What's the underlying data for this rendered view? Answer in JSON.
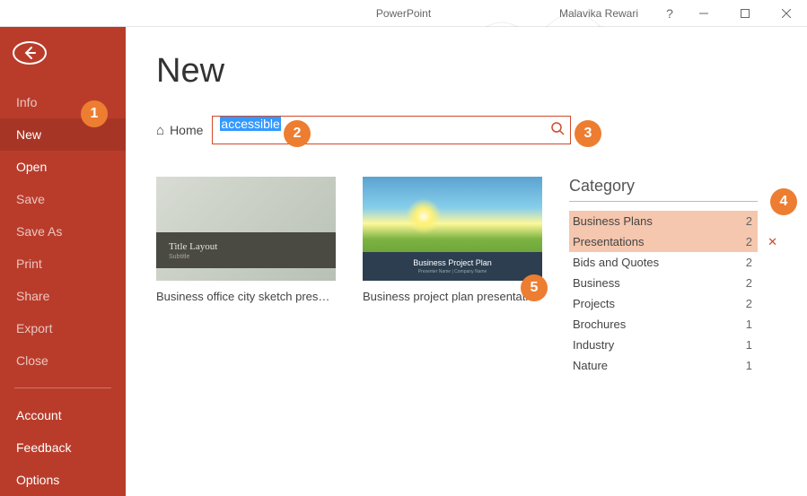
{
  "titlebar": {
    "app": "PowerPoint",
    "user": "Malavika Rewari"
  },
  "sidebar": {
    "back": "←",
    "items": [
      {
        "label": "Info",
        "active": false,
        "strong": false
      },
      {
        "label": "New",
        "active": true,
        "strong": true
      },
      {
        "label": "Open",
        "active": false,
        "strong": true
      },
      {
        "label": "Save",
        "active": false,
        "strong": false
      },
      {
        "label": "Save As",
        "active": false,
        "strong": false
      },
      {
        "label": "Print",
        "active": false,
        "strong": false
      },
      {
        "label": "Share",
        "active": false,
        "strong": false
      },
      {
        "label": "Export",
        "active": false,
        "strong": false
      },
      {
        "label": "Close",
        "active": false,
        "strong": false
      }
    ],
    "footer": [
      {
        "label": "Account"
      },
      {
        "label": "Feedback"
      },
      {
        "label": "Options"
      }
    ]
  },
  "page": {
    "title": "New",
    "home": "Home",
    "search_value": "accessible"
  },
  "templates": [
    {
      "label": "Business office city sketch prese…",
      "title": "Title Layout",
      "subtitle": "Subtitle"
    },
    {
      "label": "Business project plan presentatio…",
      "title": "Business Project Plan",
      "subtitle": "Presenter Name | Company Name"
    }
  ],
  "category": {
    "header": "Category",
    "rows": [
      {
        "name": "Business Plans",
        "count": 2,
        "selected": true
      },
      {
        "name": "Presentations",
        "count": 2,
        "selected": true,
        "clearable": true
      },
      {
        "name": "Bids and Quotes",
        "count": 2,
        "selected": false
      },
      {
        "name": "Business",
        "count": 2,
        "selected": false
      },
      {
        "name": "Projects",
        "count": 2,
        "selected": false
      },
      {
        "name": "Brochures",
        "count": 1,
        "selected": false
      },
      {
        "name": "Industry",
        "count": 1,
        "selected": false
      },
      {
        "name": "Nature",
        "count": 1,
        "selected": false
      }
    ]
  },
  "annotations": [
    "1",
    "2",
    "3",
    "4",
    "5"
  ]
}
